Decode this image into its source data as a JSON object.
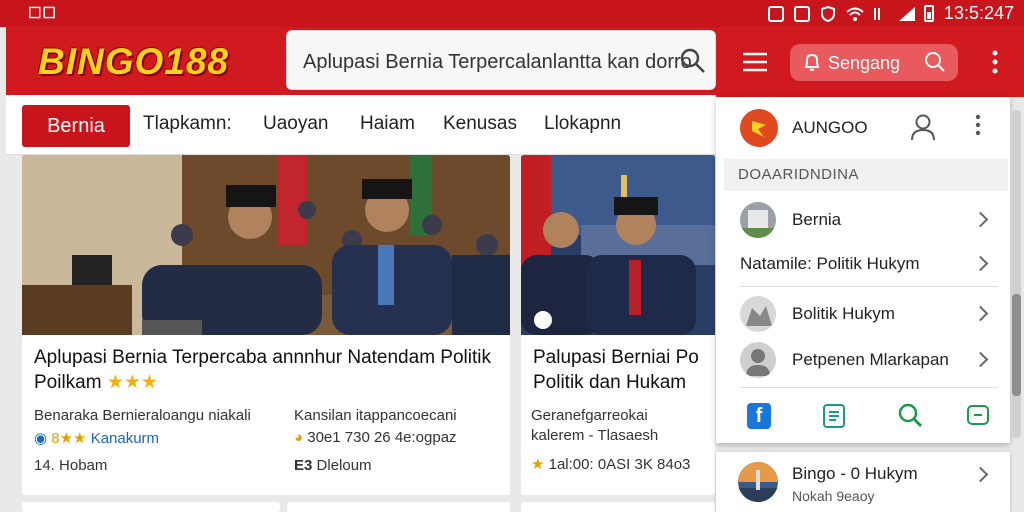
{
  "status_bar": {
    "left": "☐☐",
    "time": "13:5:247"
  },
  "header": {
    "logo": "BINGO188",
    "search_text": "Aplupasi Bernia Terpercalanlantta kan dorro"
  },
  "tabs": [
    "Bernia",
    "Tlapkamn:",
    "Uaoyan",
    "Haiam",
    "Kenusas",
    "Llokapnn"
  ],
  "cards": [
    {
      "title": "Aplupasi Bernia Terpercaba annnhur Natendam Politik Poilkam",
      "stars": "★★★",
      "meta_left": "Benaraka Bernieraloangu niakali",
      "meta_left_icon_text": "8★★",
      "meta_left_link": "Kanakurm",
      "meta_left_time": "14. Hobam",
      "meta_right": "Kansilan itappancoecani",
      "meta_right_line2": "30e1 730   26   4e:ogpaz",
      "meta_right_line3": "Dleloum",
      "meta_right_badge": "E3"
    },
    {
      "title": "Palupasi Berniai Po Politik dan Hukam",
      "meta_1": "Geranefgarreokai",
      "meta_2": "kalerem - Tlasaesh",
      "meta_3": "1al:00:  0ASI 3K 84o3"
    }
  ],
  "drawer": {
    "search_label": "Sengang",
    "profile_name": "AUNGOO",
    "section_title": "DOAARIDNDINA",
    "items": [
      "Bernia",
      "Natamile: Politik Hukym",
      "Bolitik Hukym",
      "Petpenen Mlarkapan"
    ],
    "bottom_card": {
      "title": "Bingo - 0 Hukym",
      "subtitle": "Nokah 9eaoy"
    }
  },
  "colors": {
    "brand_red": "#d01a1f",
    "logo_yellow": "#ffd21f",
    "link_blue": "#1a66c2"
  }
}
